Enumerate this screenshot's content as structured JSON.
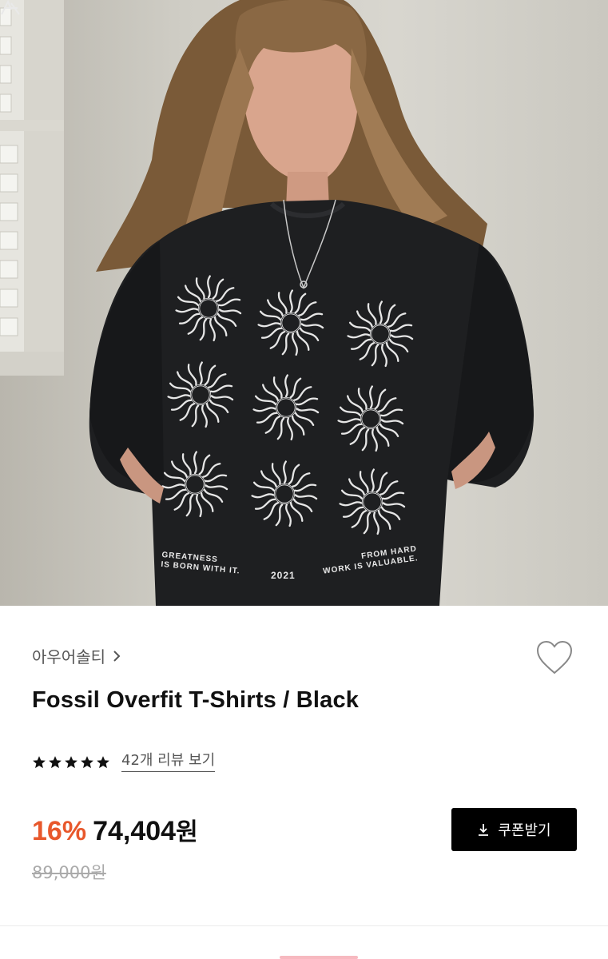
{
  "product_image": {
    "print_left": "GREATNESS\nIS BORN WITH IT.",
    "print_center": "2021",
    "print_right": "FROM HARD\nWORK IS VALUABLE."
  },
  "product": {
    "brand": "아우어솔티",
    "title": "Fossil Overfit T-Shirts / Black",
    "rating_stars": 5,
    "reviews_label": "42개 리뷰 보기",
    "discount": "16%",
    "price": "74,404",
    "price_unit": "원",
    "original_price": "89,000원",
    "coupon_label": "쿠폰받기"
  },
  "icons": {
    "brand_chevron": "chevron-right-icon",
    "wishlist": "heart-outline-icon",
    "star": "star-filled-icon",
    "coupon": "download-icon"
  },
  "colors": {
    "discount": "#e8582c",
    "button_bg": "#000000",
    "muted_text": "#555555",
    "strike_price": "#aaaaaa"
  }
}
